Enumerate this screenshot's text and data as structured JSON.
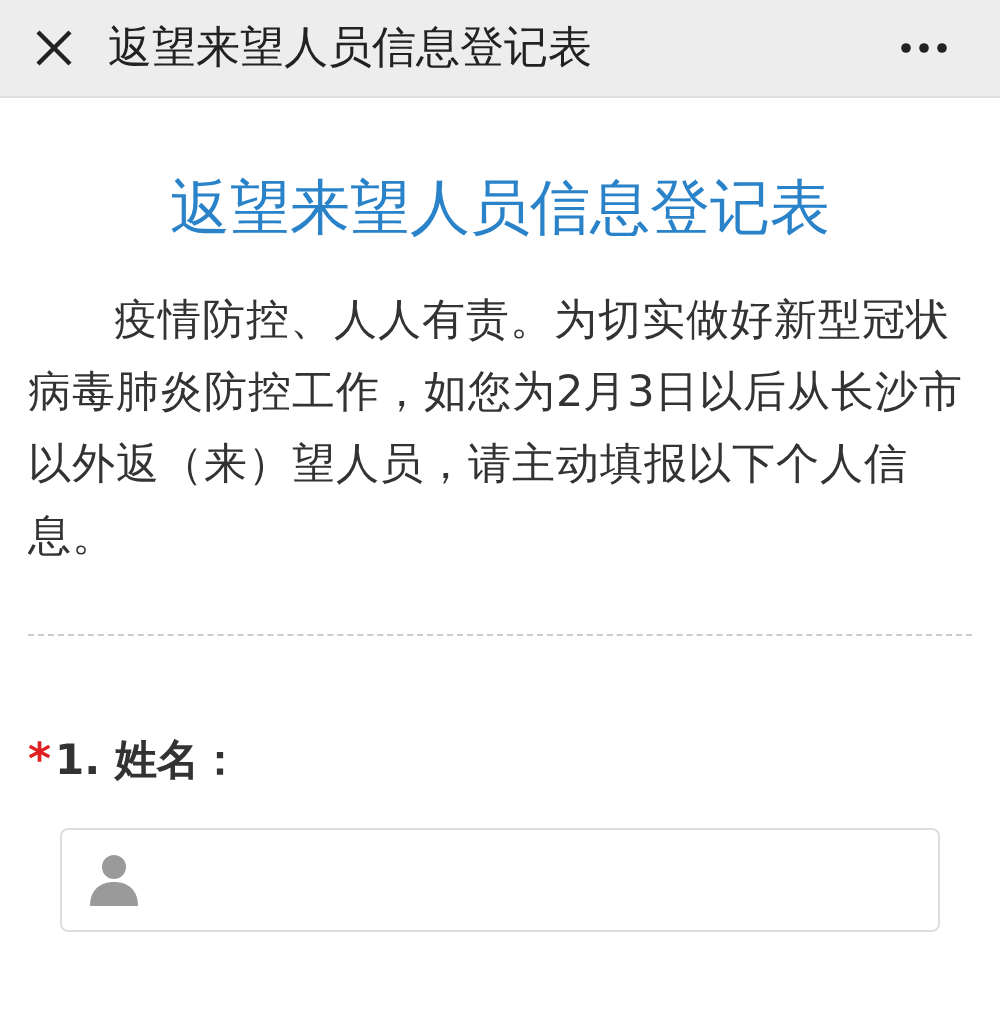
{
  "window": {
    "title": "返望来望人员信息登记表"
  },
  "form": {
    "heading": "返望来望人员信息登记表",
    "intro": "疫情防控、人人有责。为切实做好新型冠状病毒肺炎防控工作，如您为2月3日以后从长沙市以外返（来）望人员，请主动填报以下个人信息。"
  },
  "questions": [
    {
      "required": true,
      "required_mark": "*",
      "label": "1. 姓名："
    }
  ]
}
